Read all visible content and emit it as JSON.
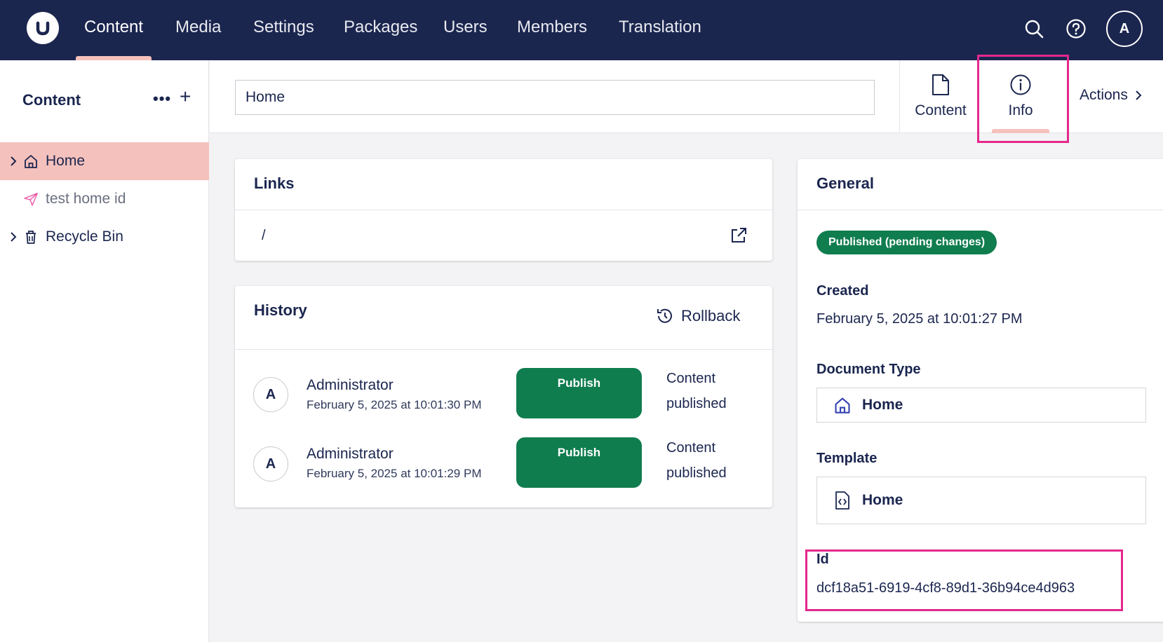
{
  "colors": {
    "topbar": "#1b264f",
    "accent_pink": "#f5c1bc",
    "publish_green": "#107d4f",
    "highlight": "#e4288c"
  },
  "topnav": {
    "items": [
      {
        "label": "Content",
        "active": true
      },
      {
        "label": "Media"
      },
      {
        "label": "Settings"
      },
      {
        "label": "Packages"
      },
      {
        "label": "Users"
      },
      {
        "label": "Members"
      },
      {
        "label": "Translation"
      }
    ],
    "avatar_initial": "A",
    "icons": [
      "search-icon",
      "help-icon"
    ]
  },
  "sidebar": {
    "title": "Content",
    "more_label": "•••",
    "add_label": "+",
    "tree": [
      {
        "label": "Home",
        "icon": "home-icon",
        "active": true,
        "expandable": true
      },
      {
        "label": "test home id",
        "icon": "send-icon",
        "muted": true
      },
      {
        "label": "Recycle Bin",
        "icon": "trash-icon",
        "expandable": true
      }
    ]
  },
  "header": {
    "name_value": "Home",
    "views": [
      {
        "label": "Content",
        "icon": "document-icon"
      },
      {
        "label": "Info",
        "icon": "info-icon",
        "active": true
      }
    ],
    "actions_label": "Actions"
  },
  "links": {
    "title": "Links",
    "url": "/"
  },
  "history": {
    "title": "History",
    "rollback_label": "Rollback",
    "entries": [
      {
        "initial": "A",
        "user": "Administrator",
        "date": "February 5, 2025 at 10:01:30 PM",
        "action": "Publish",
        "status": "Content published"
      },
      {
        "initial": "A",
        "user": "Administrator",
        "date": "February 5, 2025 at 10:01:29 PM",
        "action": "Publish",
        "status": "Content published"
      }
    ]
  },
  "general": {
    "title": "General",
    "status_badge": "Published (pending changes)",
    "created_label": "Created",
    "created_value": "February 5, 2025 at 10:01:27 PM",
    "doctype_label": "Document Type",
    "doctype_value": "Home",
    "template_label": "Template",
    "template_value": "Home",
    "id_label": "Id",
    "id_value": "dcf18a51-6919-4cf8-89d1-36b94ce4d963"
  }
}
